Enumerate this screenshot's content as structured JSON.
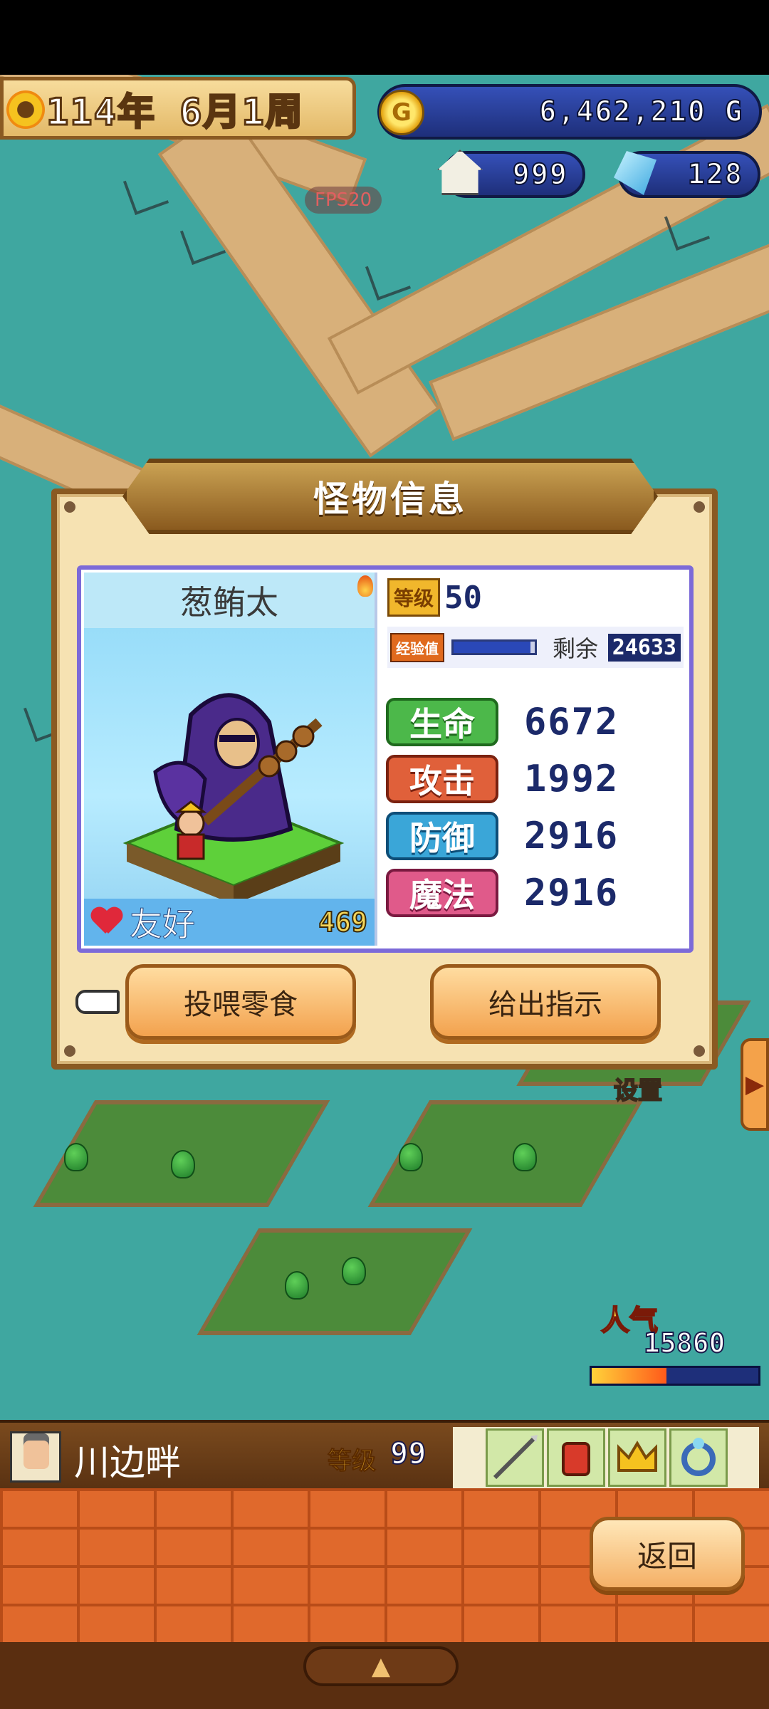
{
  "hud": {
    "date": "114年 6月1周",
    "gold": "6,462,210 G",
    "coin_symbol": "G",
    "houses": "999",
    "crystals": "128",
    "fps": "FPS20"
  },
  "dialog": {
    "title": "怪物信息",
    "monster": {
      "name": "葱鲔太",
      "friend_label": "友好",
      "friend_value": "469"
    },
    "level_label": "等级",
    "level_value": "50",
    "exp_label": "经验值",
    "exp_progress": 0.95,
    "exp_remain_label": "剩余",
    "exp_remain_value": "24633",
    "stats": [
      {
        "label": "生命",
        "value": "6672",
        "color": "#4cb84a",
        "border": "#1f6a1e"
      },
      {
        "label": "攻击",
        "value": "1992",
        "color": "#e0603a",
        "border": "#7a2210"
      },
      {
        "label": "防御",
        "value": "2916",
        "color": "#3aa6d8",
        "border": "#0d4e78"
      },
      {
        "label": "魔法",
        "value": "2916",
        "color": "#e05a8a",
        "border": "#7a1a40"
      }
    ],
    "buttons": {
      "feed": "投喂零食",
      "command": "给出指示"
    }
  },
  "side": {
    "settings": "设置",
    "tab_arrow": "▶"
  },
  "popularity": {
    "label": "人气",
    "value": "15860",
    "level": 0.45
  },
  "player": {
    "name": "川边畔",
    "level_label": "等级",
    "level_value": "99"
  },
  "footer": {
    "back": "返回",
    "collapse": "▲"
  },
  "colors": {
    "ground": "#3fa7a0",
    "road": "#d8b07a",
    "brick": "#e0692c",
    "dialog_bg": "#f6e2b2"
  }
}
